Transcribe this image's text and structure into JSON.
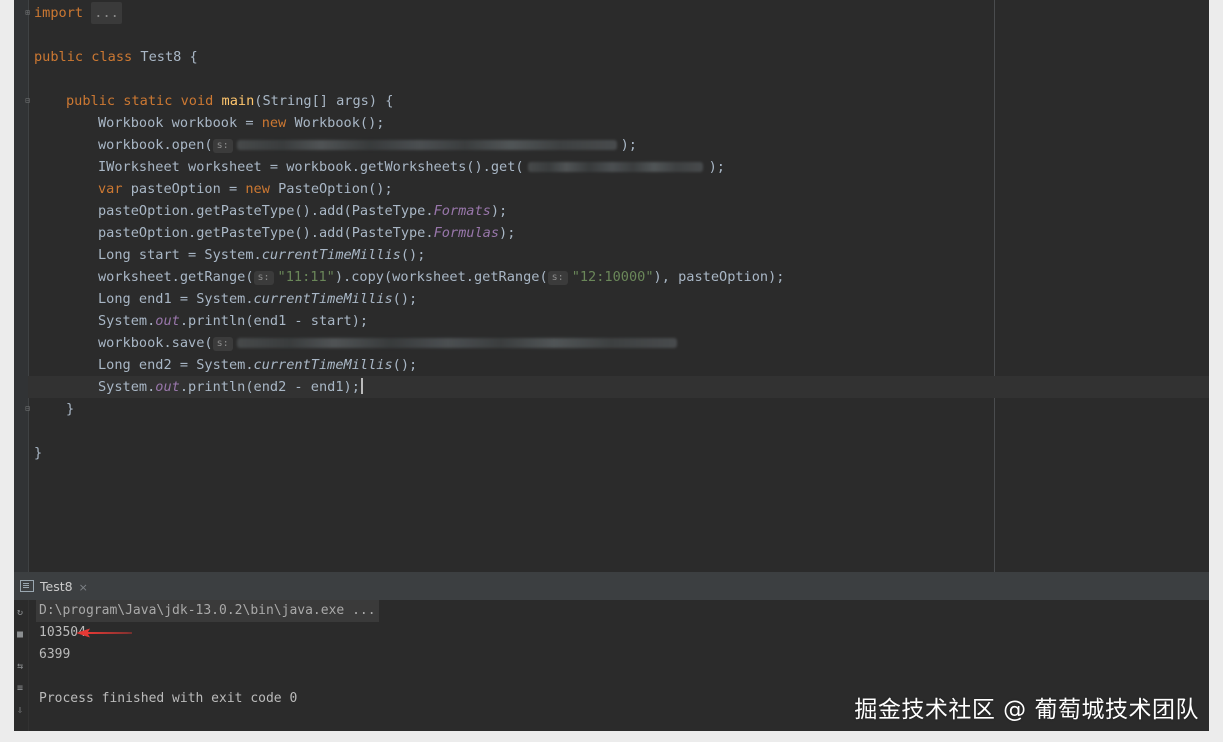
{
  "editor": {
    "lines": [
      {
        "k1": "import",
        "chip": "..."
      },
      {
        "k1": "public",
        "k2": "class",
        "t": "Test8 {"
      },
      {
        "k1": "public",
        "k2": "static",
        "k3": "void",
        "fn": "main",
        "t": "(String[] args) {"
      },
      {
        "a": "Workbook workbook = ",
        "kw": "new",
        "b": "Workbook();"
      },
      {
        "a": "workbook.open(",
        "hint": "s:",
        "b": ");"
      },
      {
        "a": "IWorksheet worksheet = workbook.getWorksheets().get(",
        "b": ");"
      },
      {
        "kw": "var",
        "a": " pasteOption = ",
        "kw2": "new",
        "b": "PasteOption();"
      },
      {
        "a": "pasteOption.getPasteType().add(PasteType.",
        "st": "Formats",
        "b": ");"
      },
      {
        "a": "pasteOption.getPasteType().add(PasteType.",
        "st": "Formulas",
        "b": ");"
      },
      {
        "a": "Long start = System.",
        "it": "currentTimeMillis",
        "b": "();"
      },
      {
        "a": "worksheet.getRange(",
        "hint": "s:",
        "str": "\"11:11\"",
        "b": ").copy(worksheet.getRange(",
        "hint2": "s:",
        "str2": "\"12:10000\"",
        "c": "), pasteOption);"
      },
      {
        "a": "Long end1 = System.",
        "it": "currentTimeMillis",
        "b": "();"
      },
      {
        "a": "System.",
        "st": "out",
        "b": ".println(end1 - start);"
      },
      {
        "a": "workbook.save(",
        "hint": "s:"
      },
      {
        "a": "Long end2 = System.",
        "it": "currentTimeMillis",
        "b": "();"
      },
      {
        "a": "System.",
        "st": "out",
        "b": ".println(end2 - end1);"
      },
      {
        "t": "}"
      },
      {
        "t": "}"
      }
    ]
  },
  "run": {
    "tab_label": "Test8",
    "tab_close": "×",
    "command": "D:\\program\\Java\\jdk-13.0.2\\bin\\java.exe ...",
    "output": [
      "103504",
      "6399"
    ],
    "exit_message": "Process finished with exit code 0"
  },
  "watermark": "掘金技术社区 @ 葡萄城技术团队",
  "colors": {
    "keyword": "#cc7832",
    "function": "#ffc66d",
    "string": "#6a8759",
    "static_field": "#9876aa",
    "arrow": "#e53935"
  }
}
